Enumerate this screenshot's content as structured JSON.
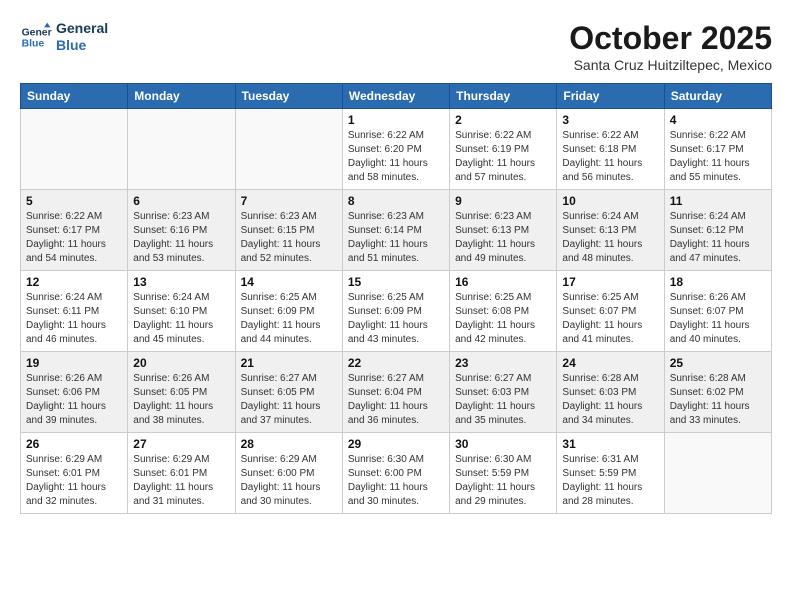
{
  "header": {
    "logo_line1": "General",
    "logo_line2": "Blue",
    "month": "October 2025",
    "location": "Santa Cruz Huitziltepec, Mexico"
  },
  "weekdays": [
    "Sunday",
    "Monday",
    "Tuesday",
    "Wednesday",
    "Thursday",
    "Friday",
    "Saturday"
  ],
  "weeks": [
    {
      "shaded": false,
      "days": [
        {
          "num": "",
          "info": ""
        },
        {
          "num": "",
          "info": ""
        },
        {
          "num": "",
          "info": ""
        },
        {
          "num": "1",
          "info": "Sunrise: 6:22 AM\nSunset: 6:20 PM\nDaylight: 11 hours\nand 58 minutes."
        },
        {
          "num": "2",
          "info": "Sunrise: 6:22 AM\nSunset: 6:19 PM\nDaylight: 11 hours\nand 57 minutes."
        },
        {
          "num": "3",
          "info": "Sunrise: 6:22 AM\nSunset: 6:18 PM\nDaylight: 11 hours\nand 56 minutes."
        },
        {
          "num": "4",
          "info": "Sunrise: 6:22 AM\nSunset: 6:17 PM\nDaylight: 11 hours\nand 55 minutes."
        }
      ]
    },
    {
      "shaded": true,
      "days": [
        {
          "num": "5",
          "info": "Sunrise: 6:22 AM\nSunset: 6:17 PM\nDaylight: 11 hours\nand 54 minutes."
        },
        {
          "num": "6",
          "info": "Sunrise: 6:23 AM\nSunset: 6:16 PM\nDaylight: 11 hours\nand 53 minutes."
        },
        {
          "num": "7",
          "info": "Sunrise: 6:23 AM\nSunset: 6:15 PM\nDaylight: 11 hours\nand 52 minutes."
        },
        {
          "num": "8",
          "info": "Sunrise: 6:23 AM\nSunset: 6:14 PM\nDaylight: 11 hours\nand 51 minutes."
        },
        {
          "num": "9",
          "info": "Sunrise: 6:23 AM\nSunset: 6:13 PM\nDaylight: 11 hours\nand 49 minutes."
        },
        {
          "num": "10",
          "info": "Sunrise: 6:24 AM\nSunset: 6:13 PM\nDaylight: 11 hours\nand 48 minutes."
        },
        {
          "num": "11",
          "info": "Sunrise: 6:24 AM\nSunset: 6:12 PM\nDaylight: 11 hours\nand 47 minutes."
        }
      ]
    },
    {
      "shaded": false,
      "days": [
        {
          "num": "12",
          "info": "Sunrise: 6:24 AM\nSunset: 6:11 PM\nDaylight: 11 hours\nand 46 minutes."
        },
        {
          "num": "13",
          "info": "Sunrise: 6:24 AM\nSunset: 6:10 PM\nDaylight: 11 hours\nand 45 minutes."
        },
        {
          "num": "14",
          "info": "Sunrise: 6:25 AM\nSunset: 6:09 PM\nDaylight: 11 hours\nand 44 minutes."
        },
        {
          "num": "15",
          "info": "Sunrise: 6:25 AM\nSunset: 6:09 PM\nDaylight: 11 hours\nand 43 minutes."
        },
        {
          "num": "16",
          "info": "Sunrise: 6:25 AM\nSunset: 6:08 PM\nDaylight: 11 hours\nand 42 minutes."
        },
        {
          "num": "17",
          "info": "Sunrise: 6:25 AM\nSunset: 6:07 PM\nDaylight: 11 hours\nand 41 minutes."
        },
        {
          "num": "18",
          "info": "Sunrise: 6:26 AM\nSunset: 6:07 PM\nDaylight: 11 hours\nand 40 minutes."
        }
      ]
    },
    {
      "shaded": true,
      "days": [
        {
          "num": "19",
          "info": "Sunrise: 6:26 AM\nSunset: 6:06 PM\nDaylight: 11 hours\nand 39 minutes."
        },
        {
          "num": "20",
          "info": "Sunrise: 6:26 AM\nSunset: 6:05 PM\nDaylight: 11 hours\nand 38 minutes."
        },
        {
          "num": "21",
          "info": "Sunrise: 6:27 AM\nSunset: 6:05 PM\nDaylight: 11 hours\nand 37 minutes."
        },
        {
          "num": "22",
          "info": "Sunrise: 6:27 AM\nSunset: 6:04 PM\nDaylight: 11 hours\nand 36 minutes."
        },
        {
          "num": "23",
          "info": "Sunrise: 6:27 AM\nSunset: 6:03 PM\nDaylight: 11 hours\nand 35 minutes."
        },
        {
          "num": "24",
          "info": "Sunrise: 6:28 AM\nSunset: 6:03 PM\nDaylight: 11 hours\nand 34 minutes."
        },
        {
          "num": "25",
          "info": "Sunrise: 6:28 AM\nSunset: 6:02 PM\nDaylight: 11 hours\nand 33 minutes."
        }
      ]
    },
    {
      "shaded": false,
      "days": [
        {
          "num": "26",
          "info": "Sunrise: 6:29 AM\nSunset: 6:01 PM\nDaylight: 11 hours\nand 32 minutes."
        },
        {
          "num": "27",
          "info": "Sunrise: 6:29 AM\nSunset: 6:01 PM\nDaylight: 11 hours\nand 31 minutes."
        },
        {
          "num": "28",
          "info": "Sunrise: 6:29 AM\nSunset: 6:00 PM\nDaylight: 11 hours\nand 30 minutes."
        },
        {
          "num": "29",
          "info": "Sunrise: 6:30 AM\nSunset: 6:00 PM\nDaylight: 11 hours\nand 30 minutes."
        },
        {
          "num": "30",
          "info": "Sunrise: 6:30 AM\nSunset: 5:59 PM\nDaylight: 11 hours\nand 29 minutes."
        },
        {
          "num": "31",
          "info": "Sunrise: 6:31 AM\nSunset: 5:59 PM\nDaylight: 11 hours\nand 28 minutes."
        },
        {
          "num": "",
          "info": ""
        }
      ]
    }
  ]
}
